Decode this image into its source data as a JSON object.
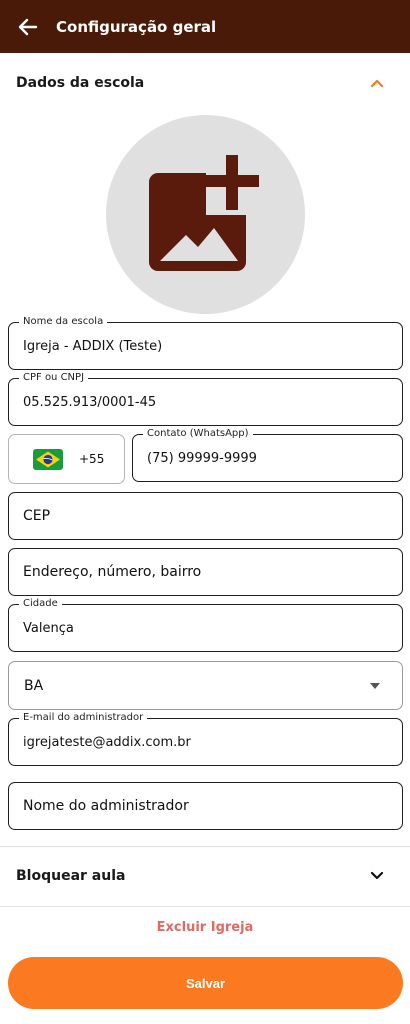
{
  "appbar": {
    "title": "Configuração geral"
  },
  "section_school": {
    "title": "Dados da escola"
  },
  "fields": {
    "school_name": {
      "label": "Nome da escola",
      "value": "Igreja - ADDIX (Teste)"
    },
    "cpf_cnpj": {
      "label": "CPF ou CNPJ",
      "value": "05.525.913/0001-45"
    },
    "country_code": "+55",
    "contact": {
      "label": "Contato (WhatsApp)",
      "value": "(75) 99999-9999"
    },
    "cep": {
      "placeholder": "CEP"
    },
    "address": {
      "placeholder": "Endereço, número, bairro"
    },
    "city": {
      "label": "Cidade",
      "value": "Valença"
    },
    "state": {
      "value": "BA"
    },
    "admin_email": {
      "label": "E-mail do administrador",
      "value": "igrejateste@addix.com.br"
    },
    "admin_name": {
      "placeholder": "Nome do administrador"
    }
  },
  "section_block": {
    "title": "Bloquear aula"
  },
  "actions": {
    "delete": "Excluir Igreja",
    "save": "Salvar"
  },
  "colors": {
    "appbar": "#4a1a08",
    "accent": "#fb7a21",
    "danger": "#e06a62",
    "image_icon": "#5a1a0c"
  },
  "icons": {
    "back": "arrow-left-icon",
    "collapse": "chevron-up-icon",
    "expand": "chevron-down-icon",
    "add_image": "add-photo-icon",
    "flag": "brazil-flag-icon"
  }
}
